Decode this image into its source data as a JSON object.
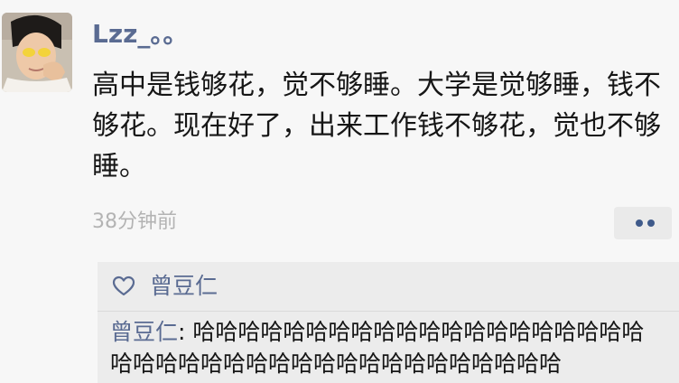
{
  "post": {
    "username": "Lzz_。。",
    "content": "高中是钱够花，觉不够睡。大学是觉够睡，钱不够花。现在好了，出来工作钱不够花，觉也不够睡。",
    "time": "38分钟前"
  },
  "interactions": {
    "likes": [
      "曾豆仁"
    ],
    "comments": [
      {
        "author": "曾豆仁",
        "separator": ": ",
        "text": "哈哈哈哈哈哈哈哈哈哈哈哈哈哈哈哈哈哈哈哈哈哈哈哈哈哈哈哈哈哈哈哈哈哈哈哈哈哈哈哈"
      }
    ]
  },
  "colors": {
    "name": "#5a6b92",
    "text": "#161616",
    "muted": "#b3b3b3",
    "background": "#f7f7f7",
    "panel": "#ececec"
  }
}
